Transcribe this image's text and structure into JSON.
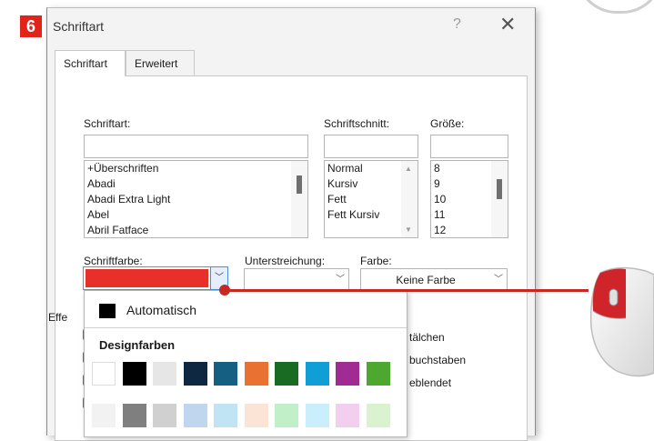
{
  "step_number": "6",
  "window": {
    "title": "Schriftart",
    "help": "?",
    "close": "✕"
  },
  "tabs": [
    {
      "label": "Schriftart"
    },
    {
      "label": "Erweitert"
    }
  ],
  "font": {
    "label": "Schriftart:",
    "value": "",
    "items": [
      "+Überschriften",
      "Abadi",
      "Abadi Extra Light",
      "Abel",
      "Abril Fatface"
    ]
  },
  "style": {
    "label": "Schriftschnitt:",
    "value": "",
    "items": [
      "Normal",
      "Kursiv",
      "Fett",
      "Fett Kursiv"
    ]
  },
  "size": {
    "label": "Größe:",
    "value": "",
    "items": [
      "8",
      "9",
      "10",
      "11",
      "12"
    ]
  },
  "font_color": {
    "label": "Schriftfarbe:",
    "selected_color": "#e8302a"
  },
  "underline": {
    "label": "Unterstreichung:",
    "value": ""
  },
  "underline_color": {
    "label": "Farbe:",
    "value": "Keine Farbe"
  },
  "effects_partial": "Effe",
  "effects_fragments": [
    "tälchen",
    "buchstaben",
    "eblendet"
  ],
  "color_menu": {
    "automatic": "Automatisch",
    "theme_heading": "Designfarben",
    "theme_colors_row1": [
      "#ffffff",
      "#000000",
      "#e7e6e6",
      "#0e2841",
      "#156082",
      "#e97132",
      "#196b24",
      "#0f9ed5",
      "#a02b93",
      "#4ea72e"
    ],
    "theme_colors_row2": [
      "#f2f2f2",
      "#7f7f7f",
      "#d0d0d0",
      "#c0d5ee",
      "#c1e4f5",
      "#fbe3d6",
      "#c1f0c8",
      "#caeefb",
      "#f2cfee",
      "#daf2d0"
    ]
  },
  "accent_color": "#c52a22"
}
